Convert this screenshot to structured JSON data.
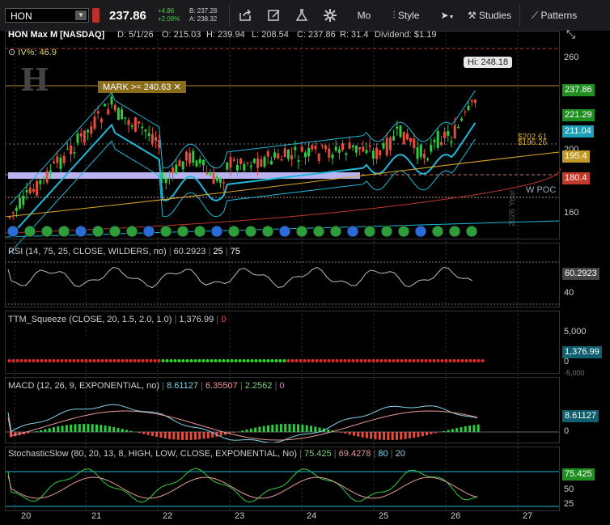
{
  "toolbar": {
    "symbol": "HON",
    "price": "237.86",
    "change_abs": "+4.86",
    "change_pct": "+2.09%",
    "bid": "B: 237.28",
    "ask": "A: 238.32",
    "period_label": "Mo",
    "style_label": "Style",
    "studies_label": "Studies",
    "patterns_label": "Patterns"
  },
  "header": {
    "title": "HON Max M [NASDAQ]",
    "date": "D: 5/1/26",
    "open": "O: 215.03",
    "high": "H: 239.94",
    "low": "L: 208.54",
    "close": "C: 237.86",
    "range": "R: 31.4",
    "dividend": "Dividend: $1.19"
  },
  "annotations": {
    "iv": "IV%: 46.9",
    "mark": "MARK >= 240.63",
    "hi": "Hi: 248.18",
    "wpoc": "W POC",
    "level1": "$202.61",
    "level2": "$196.26",
    "year_label": "2026 Year"
  },
  "price_axis": {
    "ticks": [
      "260",
      "200",
      "160"
    ],
    "badges": [
      {
        "value": "237.86",
        "color": "#1f8f1f"
      },
      {
        "value": "221.29",
        "color": "#1f8f1f"
      },
      {
        "value": "211.04",
        "color": "#1e9fb8"
      },
      {
        "value": "195.4",
        "color": "#c29a2a"
      },
      {
        "value": "180.4",
        "color": "#c0392b"
      }
    ]
  },
  "rsi": {
    "title": "RSI (14, 75, 25, CLOSE, WILDERS, no)",
    "value": "60.2923",
    "p1": "25",
    "p2": "75",
    "tick": "40"
  },
  "squeeze": {
    "title": "TTM_Squeeze (CLOSE, 20, 1.5, 2.0, 1.0)",
    "value": "1,376.99",
    "p1": "0",
    "tick_top": "5,000",
    "tick_zero": "0",
    "tick_bottom": "-5,000"
  },
  "macd": {
    "title": "MACD (12, 26, 9, EXPONENTIAL, no)",
    "v1": "8.61127",
    "v2": "6.35507",
    "v3": "2.2562",
    "v4": "0",
    "tick_zero": "0"
  },
  "stoch": {
    "title": "StochasticSlow (80, 20, 13, 8, HIGH, LOW, CLOSE, EXPONENTIAL, No)",
    "v1": "75.425",
    "v2": "69.4278",
    "p1": "80",
    "p2": "20",
    "tick1": "50",
    "tick2": "25"
  },
  "x_axis": [
    "20",
    "21",
    "22",
    "23",
    "24",
    "25",
    "26",
    "27"
  ],
  "colors": {
    "up": "#2ecc40",
    "down": "#e74c3c",
    "price_line": "#1fb8d8",
    "ma_slow": "#d9a82a"
  }
}
